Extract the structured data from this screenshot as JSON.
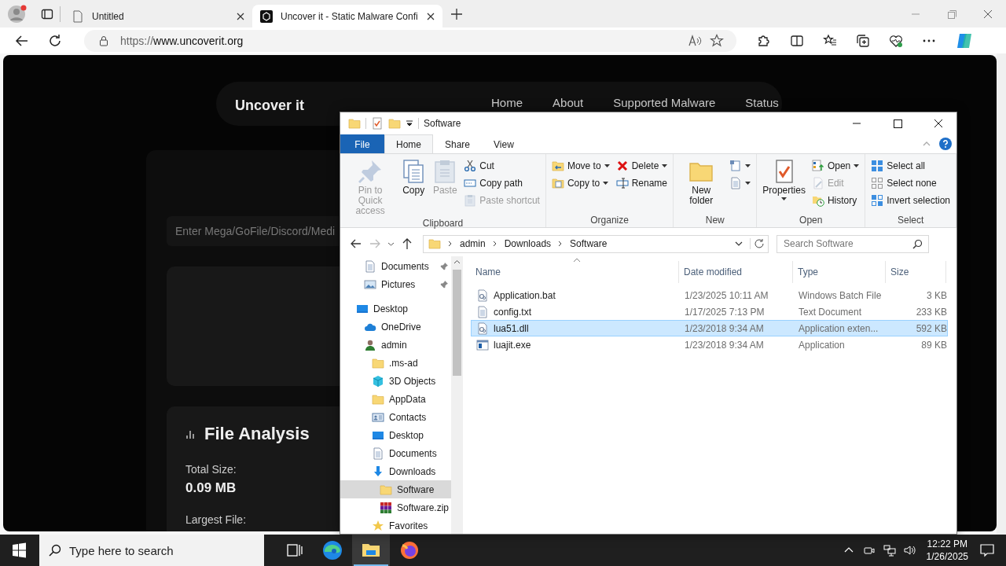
{
  "browser": {
    "tabs": [
      {
        "title": "Untitled",
        "kind": "blank",
        "selected": false
      },
      {
        "title": "Uncover it - Static Malware Confi",
        "kind": "site",
        "selected": true
      }
    ],
    "url_scheme": "https://",
    "url_host": "www.uncoverit.org"
  },
  "website": {
    "brand": "Uncover it",
    "nav_links": [
      "Home",
      "About",
      "Supported Malware",
      "Status"
    ],
    "url_input_placeholder": "Enter Mega/GoFile/Discord/Medi",
    "analysis": {
      "title": "File Analysis",
      "stats": [
        {
          "label": "Total Size:",
          "value": "0.09 MB"
        },
        {
          "label": "Largest File:"
        }
      ]
    }
  },
  "explorer": {
    "title": "Software",
    "ribbon_tabs": [
      {
        "label": "File",
        "kind": "file",
        "selected": false
      },
      {
        "label": "Home",
        "kind": "tab",
        "selected": true
      },
      {
        "label": "Share",
        "kind": "tab",
        "selected": false
      },
      {
        "label": "View",
        "kind": "tab",
        "selected": false
      }
    ],
    "ribbon_groups": [
      {
        "name": "Clipboard",
        "columns": [
          {
            "kind": "large",
            "items": [
              {
                "kind": "pin",
                "label": "Pin to Quick access",
                "disabled": true,
                "dropdown": false
              }
            ]
          },
          {
            "kind": "large",
            "items": [
              {
                "kind": "copy",
                "label": "Copy",
                "disabled": false,
                "dropdown": false
              }
            ]
          },
          {
            "kind": "large",
            "items": [
              {
                "kind": "paste",
                "label": "Paste",
                "disabled": true,
                "dropdown": false
              }
            ]
          },
          {
            "kind": "small",
            "items": [
              {
                "kind": "cut",
                "label": "Cut",
                "disabled": false,
                "dropdown": false
              },
              {
                "kind": "copy-path",
                "label": "Copy path",
                "disabled": false,
                "dropdown": false
              },
              {
                "kind": "paste-shortcut",
                "label": "Paste shortcut",
                "disabled": true,
                "dropdown": false
              }
            ]
          }
        ]
      },
      {
        "name": "Organize",
        "columns": [
          {
            "kind": "small",
            "items": [
              {
                "kind": "move-to",
                "label": "Move to",
                "disabled": false,
                "dropdown": true
              },
              {
                "kind": "copy-to",
                "label": "Copy to",
                "disabled": false,
                "dropdown": true
              }
            ]
          },
          {
            "kind": "small",
            "items": [
              {
                "kind": "delete",
                "label": "Delete",
                "disabled": false,
                "dropdown": true
              },
              {
                "kind": "rename",
                "label": "Rename",
                "disabled": false,
                "dropdown": false
              }
            ]
          }
        ]
      },
      {
        "name": "New",
        "columns": [
          {
            "kind": "large",
            "items": [
              {
                "kind": "new-folder",
                "label": "New folder",
                "disabled": false,
                "dropdown": false
              }
            ]
          },
          {
            "kind": "small",
            "items": [
              {
                "kind": "new-item",
                "disabled": false,
                "dropdown": true
              },
              {
                "kind": "easy-access",
                "disabled": false,
                "dropdown": true
              }
            ]
          }
        ]
      },
      {
        "name": "Open",
        "columns": [
          {
            "kind": "large",
            "items": [
              {
                "kind": "properties",
                "label": "Properties",
                "disabled": false,
                "dropdown": true
              }
            ]
          },
          {
            "kind": "small",
            "items": [
              {
                "kind": "open",
                "label": "Open",
                "disabled": false,
                "dropdown": true
              },
              {
                "kind": "edit",
                "label": "Edit",
                "disabled": true,
                "dropdown": false
              },
              {
                "kind": "history",
                "label": "History",
                "disabled": false,
                "dropdown": false
              }
            ]
          }
        ]
      },
      {
        "name": "Select",
        "columns": [
          {
            "kind": "small",
            "items": [
              {
                "kind": "select-all",
                "label": "Select all",
                "disabled": false,
                "dropdown": false
              },
              {
                "kind": "select-none",
                "label": "Select none",
                "disabled": false,
                "dropdown": false
              },
              {
                "kind": "invert",
                "label": "Invert selection",
                "disabled": false,
                "dropdown": false
              }
            ]
          }
        ]
      }
    ],
    "breadcrumb": [
      "admin",
      "Downloads",
      "Software"
    ],
    "search_placeholder": "Search Software",
    "quick_access": [
      {
        "label": "Documents",
        "kind": "documents",
        "pinned": true,
        "selected": false
      },
      {
        "label": "Pictures",
        "kind": "pictures",
        "pinned": true,
        "selected": false
      }
    ],
    "tree": [
      {
        "label": "Desktop",
        "kind": "desktop",
        "selected": false,
        "children": [
          {
            "label": "OneDrive",
            "kind": "cloud",
            "selected": false
          },
          {
            "label": "admin",
            "kind": "user",
            "selected": false,
            "children": [
              {
                "label": ".ms-ad",
                "kind": "folder",
                "selected": false
              },
              {
                "label": "3D Objects",
                "kind": "cube",
                "selected": false
              },
              {
                "label": "AppData",
                "kind": "folder",
                "selected": false
              },
              {
                "label": "Contacts",
                "kind": "contacts",
                "selected": false
              },
              {
                "label": "Desktop",
                "kind": "desktop",
                "selected": false
              },
              {
                "label": "Documents",
                "kind": "documents",
                "selected": false
              },
              {
                "label": "Downloads",
                "kind": "downloads",
                "selected": false,
                "children": [
                  {
                    "label": "Software",
                    "kind": "folder",
                    "selected": true
                  },
                  {
                    "label": "Software.zip",
                    "kind": "archive",
                    "selected": false
                  }
                ]
              },
              {
                "label": "Favorites",
                "kind": "star",
                "selected": false
              }
            ]
          }
        ]
      }
    ],
    "columns": [
      "Name",
      "Date modified",
      "Type",
      "Size"
    ],
    "files": [
      {
        "name": "Application.bat",
        "kind": "bat",
        "date": "1/23/2025 10:11 AM",
        "type": "Windows Batch File",
        "size": "3 KB",
        "selected": false
      },
      {
        "name": "config.txt",
        "kind": "txt",
        "date": "1/17/2025 7:13 PM",
        "type": "Text Document",
        "size": "233 KB",
        "selected": false
      },
      {
        "name": "lua51.dll",
        "kind": "dll",
        "date": "1/23/2018 9:34 AM",
        "type": "Application exten...",
        "size": "592 KB",
        "selected": true
      },
      {
        "name": "luajit.exe",
        "kind": "exe",
        "date": "1/23/2018 9:34 AM",
        "type": "Application",
        "size": "89 KB",
        "selected": false
      }
    ]
  },
  "taskbar": {
    "search_placeholder": "Type here to search",
    "time": "12:22 PM",
    "date": "1/26/2025"
  }
}
